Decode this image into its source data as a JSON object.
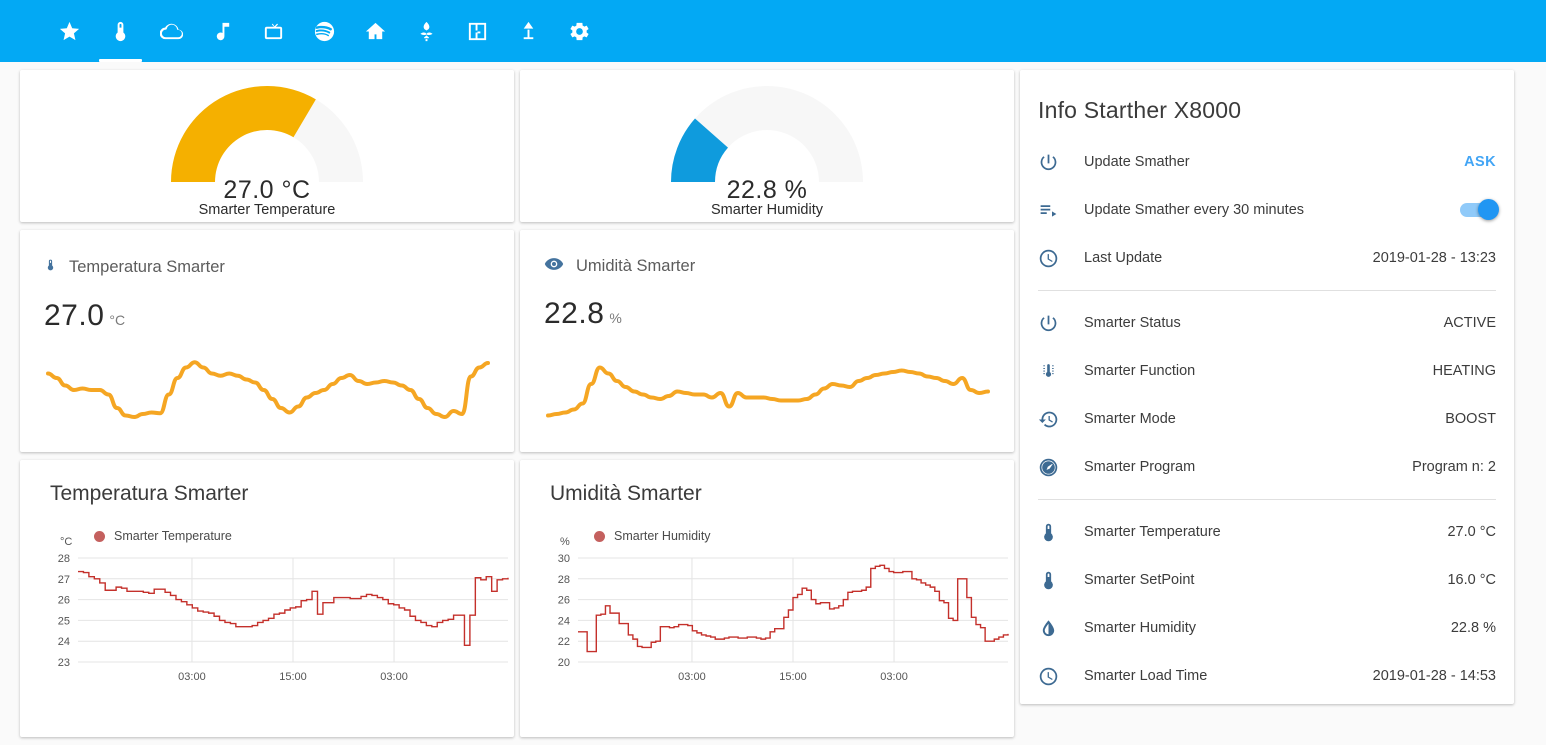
{
  "appbar": {
    "accent_color": "#03a9f4",
    "tabs": [
      {
        "icon": "star-icon",
        "name": "tab-favorites",
        "active": false
      },
      {
        "icon": "thermometer-icon",
        "name": "tab-climate",
        "active": true
      },
      {
        "icon": "cloud-icon",
        "name": "tab-weather",
        "active": false
      },
      {
        "icon": "music-note-icon",
        "name": "tab-music",
        "active": false
      },
      {
        "icon": "television-icon",
        "name": "tab-tv",
        "active": false
      },
      {
        "icon": "spotify-icon",
        "name": "tab-spotify",
        "active": false
      },
      {
        "icon": "home-icon",
        "name": "tab-home",
        "active": false
      },
      {
        "icon": "flower-icon",
        "name": "tab-plants",
        "active": false
      },
      {
        "icon": "floorplan-icon",
        "name": "tab-floorplan",
        "active": false
      },
      {
        "icon": "lamp-icon",
        "name": "tab-lights",
        "active": false
      },
      {
        "icon": "gear-icon",
        "name": "tab-settings",
        "active": false
      }
    ]
  },
  "gauges": [
    {
      "value_text": "27.0 °C",
      "label": "Smarter Temperature",
      "percent": 67,
      "color": "#f5b000",
      "track_color": "#f7f7f7"
    },
    {
      "value_text": "22.8 %",
      "label": "Smarter Humidity",
      "percent": 23,
      "color": "#0f9bdd",
      "track_color": "#f7f7f7"
    }
  ],
  "sensors": [
    {
      "icon": "thermometer-icon",
      "title": "Temperatura Smarter",
      "value": "27.0",
      "unit": "°C",
      "line_color": "#f5a623"
    },
    {
      "icon": "eye-icon",
      "title": "Umidità Smarter",
      "value": "22.8",
      "unit": "%",
      "line_color": "#f5a623"
    }
  ],
  "charts": [
    {
      "title": "Temperatura Smarter",
      "legend": "Smarter Temperature",
      "unit": "°C",
      "color": "#c4302b"
    },
    {
      "title": "Umidità Smarter",
      "legend": "Smarter Humidity",
      "unit": "%",
      "color": "#c4302b"
    }
  ],
  "chart_data": [
    {
      "type": "line",
      "title": "Temperatura Smarter",
      "ylabel": "°C",
      "xlabel": "",
      "legend": [
        "Smarter Temperature"
      ],
      "legend_position": "top-left",
      "grid": true,
      "ylim": [
        23,
        28
      ],
      "yticks": [
        23,
        24,
        25,
        26,
        27,
        28
      ],
      "xticks": [
        "03:00",
        "15:00",
        "03:00"
      ],
      "xtick_positions": [
        0.265,
        0.5,
        0.735
      ],
      "series": [
        {
          "name": "Smarter Temperature",
          "color": "#c4302b",
          "step": true,
          "values": [
            27.35,
            27.3,
            27.1,
            27.0,
            26.8,
            26.45,
            26.45,
            26.6,
            26.55,
            26.4,
            26.4,
            26.4,
            26.35,
            26.3,
            26.5,
            26.5,
            26.35,
            26.2,
            26.0,
            25.9,
            25.75,
            25.6,
            25.45,
            25.4,
            25.35,
            25.2,
            25.0,
            24.9,
            24.85,
            24.7,
            24.7,
            24.7,
            24.75,
            24.9,
            25.0,
            25.1,
            25.3,
            25.35,
            25.5,
            25.6,
            25.65,
            25.95,
            26.0,
            26.4,
            25.3,
            25.85,
            25.85,
            26.1,
            26.1,
            26.1,
            26.05,
            26.05,
            26.15,
            26.25,
            26.2,
            26.1,
            26.0,
            25.8,
            25.75,
            25.6,
            25.5,
            25.2,
            25.0,
            24.9,
            24.75,
            24.7,
            24.9,
            25.0,
            25.05,
            25.25,
            25.25,
            23.8,
            25.25,
            27.05,
            26.95,
            27.1,
            26.4,
            26.95,
            27.0,
            27.05
          ]
        }
      ]
    },
    {
      "type": "line",
      "title": "Umidità Smarter",
      "ylabel": "%",
      "xlabel": "",
      "legend": [
        "Smarter Humidity"
      ],
      "legend_position": "top-left",
      "grid": true,
      "ylim": [
        20,
        30
      ],
      "yticks": [
        20,
        22,
        24,
        26,
        28,
        30
      ],
      "xticks": [
        "03:00",
        "15:00",
        "03:00"
      ],
      "xtick_positions": [
        0.265,
        0.5,
        0.735
      ],
      "series": [
        {
          "name": "Smarter Humidity",
          "color": "#c4302b",
          "step": true,
          "values": [
            22.9,
            22.9,
            21.0,
            21.0,
            24.5,
            24.6,
            25.4,
            24.7,
            24.7,
            23.7,
            23.7,
            22.6,
            22.2,
            21.5,
            21.4,
            21.4,
            21.9,
            22.0,
            23.4,
            23.4,
            23.3,
            23.4,
            23.6,
            23.6,
            23.5,
            23.0,
            22.8,
            22.6,
            22.5,
            22.4,
            22.2,
            22.2,
            22.3,
            22.4,
            22.4,
            22.3,
            22.3,
            22.4,
            22.4,
            22.3,
            22.2,
            22.3,
            22.9,
            23.2,
            23.2,
            24.3,
            25.0,
            26.2,
            26.5,
            27.1,
            26.9,
            26.0,
            25.6,
            25.7,
            25.7,
            25.1,
            25.2,
            25.4,
            26.0,
            26.7,
            26.8,
            26.8,
            26.9,
            27.2,
            29.0,
            29.2,
            29.3,
            29.0,
            28.7,
            28.6,
            28.6,
            28.7,
            28.7,
            28.0,
            27.9,
            27.6,
            27.4,
            27.2,
            26.8,
            25.9,
            25.7,
            24.2,
            24.0,
            28.0,
            28.0,
            26.2,
            24.3,
            23.6,
            23.3,
            22.0,
            22.0,
            22.2,
            22.4,
            22.6,
            22.7
          ]
        }
      ]
    }
  ],
  "info": {
    "title": "Info Starther X8000",
    "group1": [
      {
        "icon": "power-icon",
        "label": "Update Smather",
        "value": "ASK",
        "value_style": "ask"
      },
      {
        "icon": "playlist-icon",
        "label": "Update Smather every 30 minutes",
        "value": "",
        "value_style": "toggle",
        "toggle_on": true
      },
      {
        "icon": "clock-icon",
        "label": "Last Update",
        "value": "2019-01-28 - 13:23",
        "value_style": "plain"
      }
    ],
    "group2": [
      {
        "icon": "power-icon",
        "label": "Smarter Status",
        "value": "ACTIVE",
        "value_style": "plain"
      },
      {
        "icon": "thermo-lines-icon",
        "label": "Smarter Function",
        "value": "HEATING",
        "value_style": "plain"
      },
      {
        "icon": "history-icon",
        "label": "Smarter Mode",
        "value": "BOOST",
        "value_style": "plain"
      },
      {
        "icon": "speedometer-icon",
        "label": "Smarter Program",
        "value": "Program n: 2",
        "value_style": "plain"
      }
    ],
    "group3": [
      {
        "icon": "thermometer-icon",
        "label": "Smarter Temperature",
        "value": "27.0 °C",
        "value_style": "plain"
      },
      {
        "icon": "thermometer-icon",
        "label": "Smarter SetPoint",
        "value": "16.0 °C",
        "value_style": "plain"
      },
      {
        "icon": "water-icon",
        "label": "Smarter Humidity",
        "value": "22.8 %",
        "value_style": "plain"
      },
      {
        "icon": "clock-icon",
        "label": "Smarter Load Time",
        "value": "2019-01-28 - 14:53",
        "value_style": "plain"
      }
    ]
  }
}
